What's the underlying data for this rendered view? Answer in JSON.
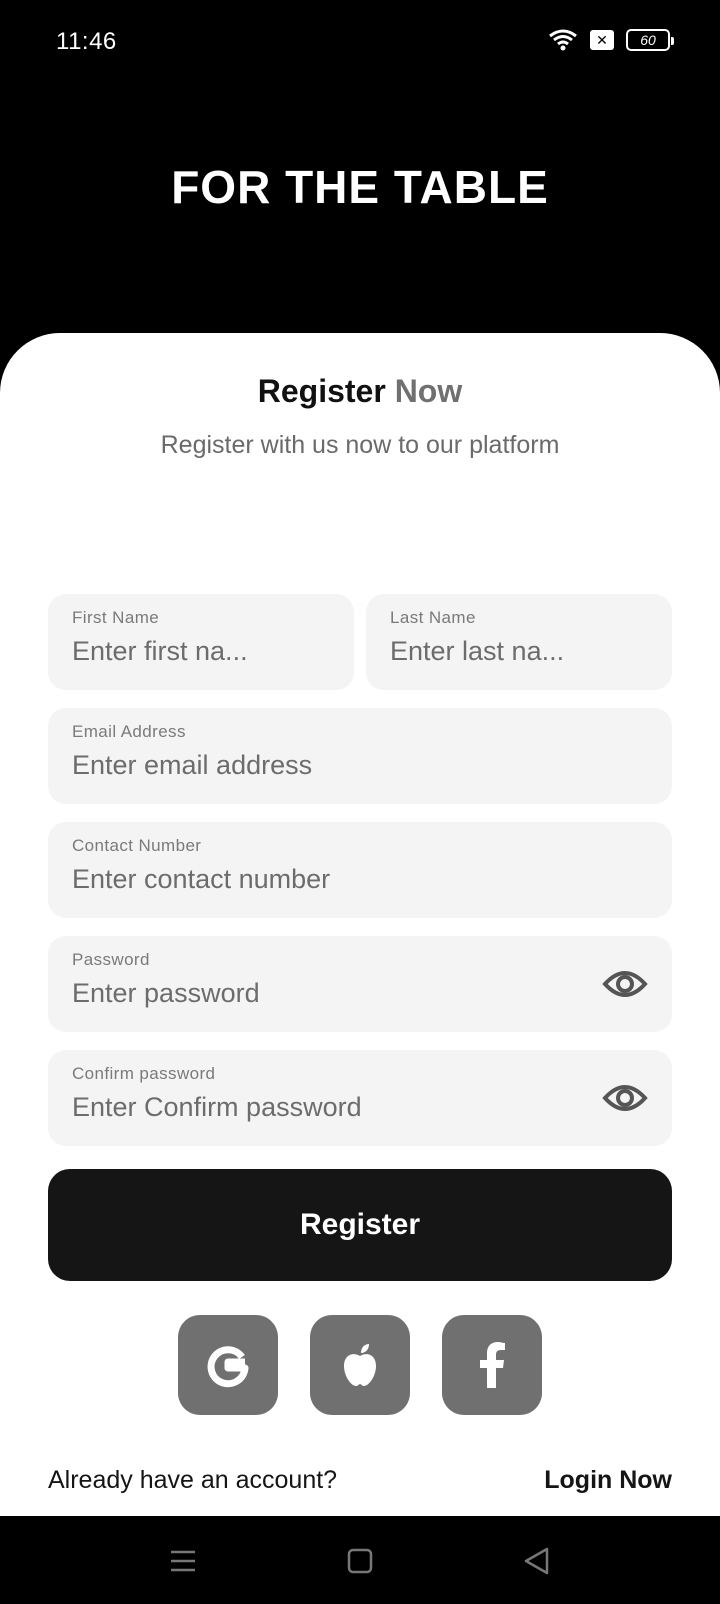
{
  "status_bar": {
    "time": "11:46",
    "battery": "60"
  },
  "header": {
    "title": "FOR THE TABLE"
  },
  "form": {
    "heading_primary": "Register",
    "heading_accent": "Now",
    "subtitle": "Register with us now to our platform",
    "first_name": {
      "label": "First Name",
      "placeholder": "Enter first na..."
    },
    "last_name": {
      "label": "Last Name",
      "placeholder": "Enter last na..."
    },
    "email": {
      "label": "Email Address",
      "placeholder": "Enter email address"
    },
    "contact": {
      "label": "Contact Number",
      "placeholder": "Enter contact number"
    },
    "password": {
      "label": "Password",
      "placeholder": "Enter password"
    },
    "confirm_password": {
      "label": "Confirm password",
      "placeholder": "Enter Confirm password"
    },
    "register_label": "Register"
  },
  "social": [
    {
      "icon": "google-icon"
    },
    {
      "icon": "apple-icon"
    },
    {
      "icon": "facebook-icon"
    }
  ],
  "footer": {
    "prompt": "Already have an account?",
    "login_label": "Login Now"
  },
  "colors": {
    "background": "#000000",
    "card": "#ffffff",
    "field": "#f4f4f4",
    "button": "#151515",
    "social": "#707070",
    "accent_text": "#707070"
  }
}
